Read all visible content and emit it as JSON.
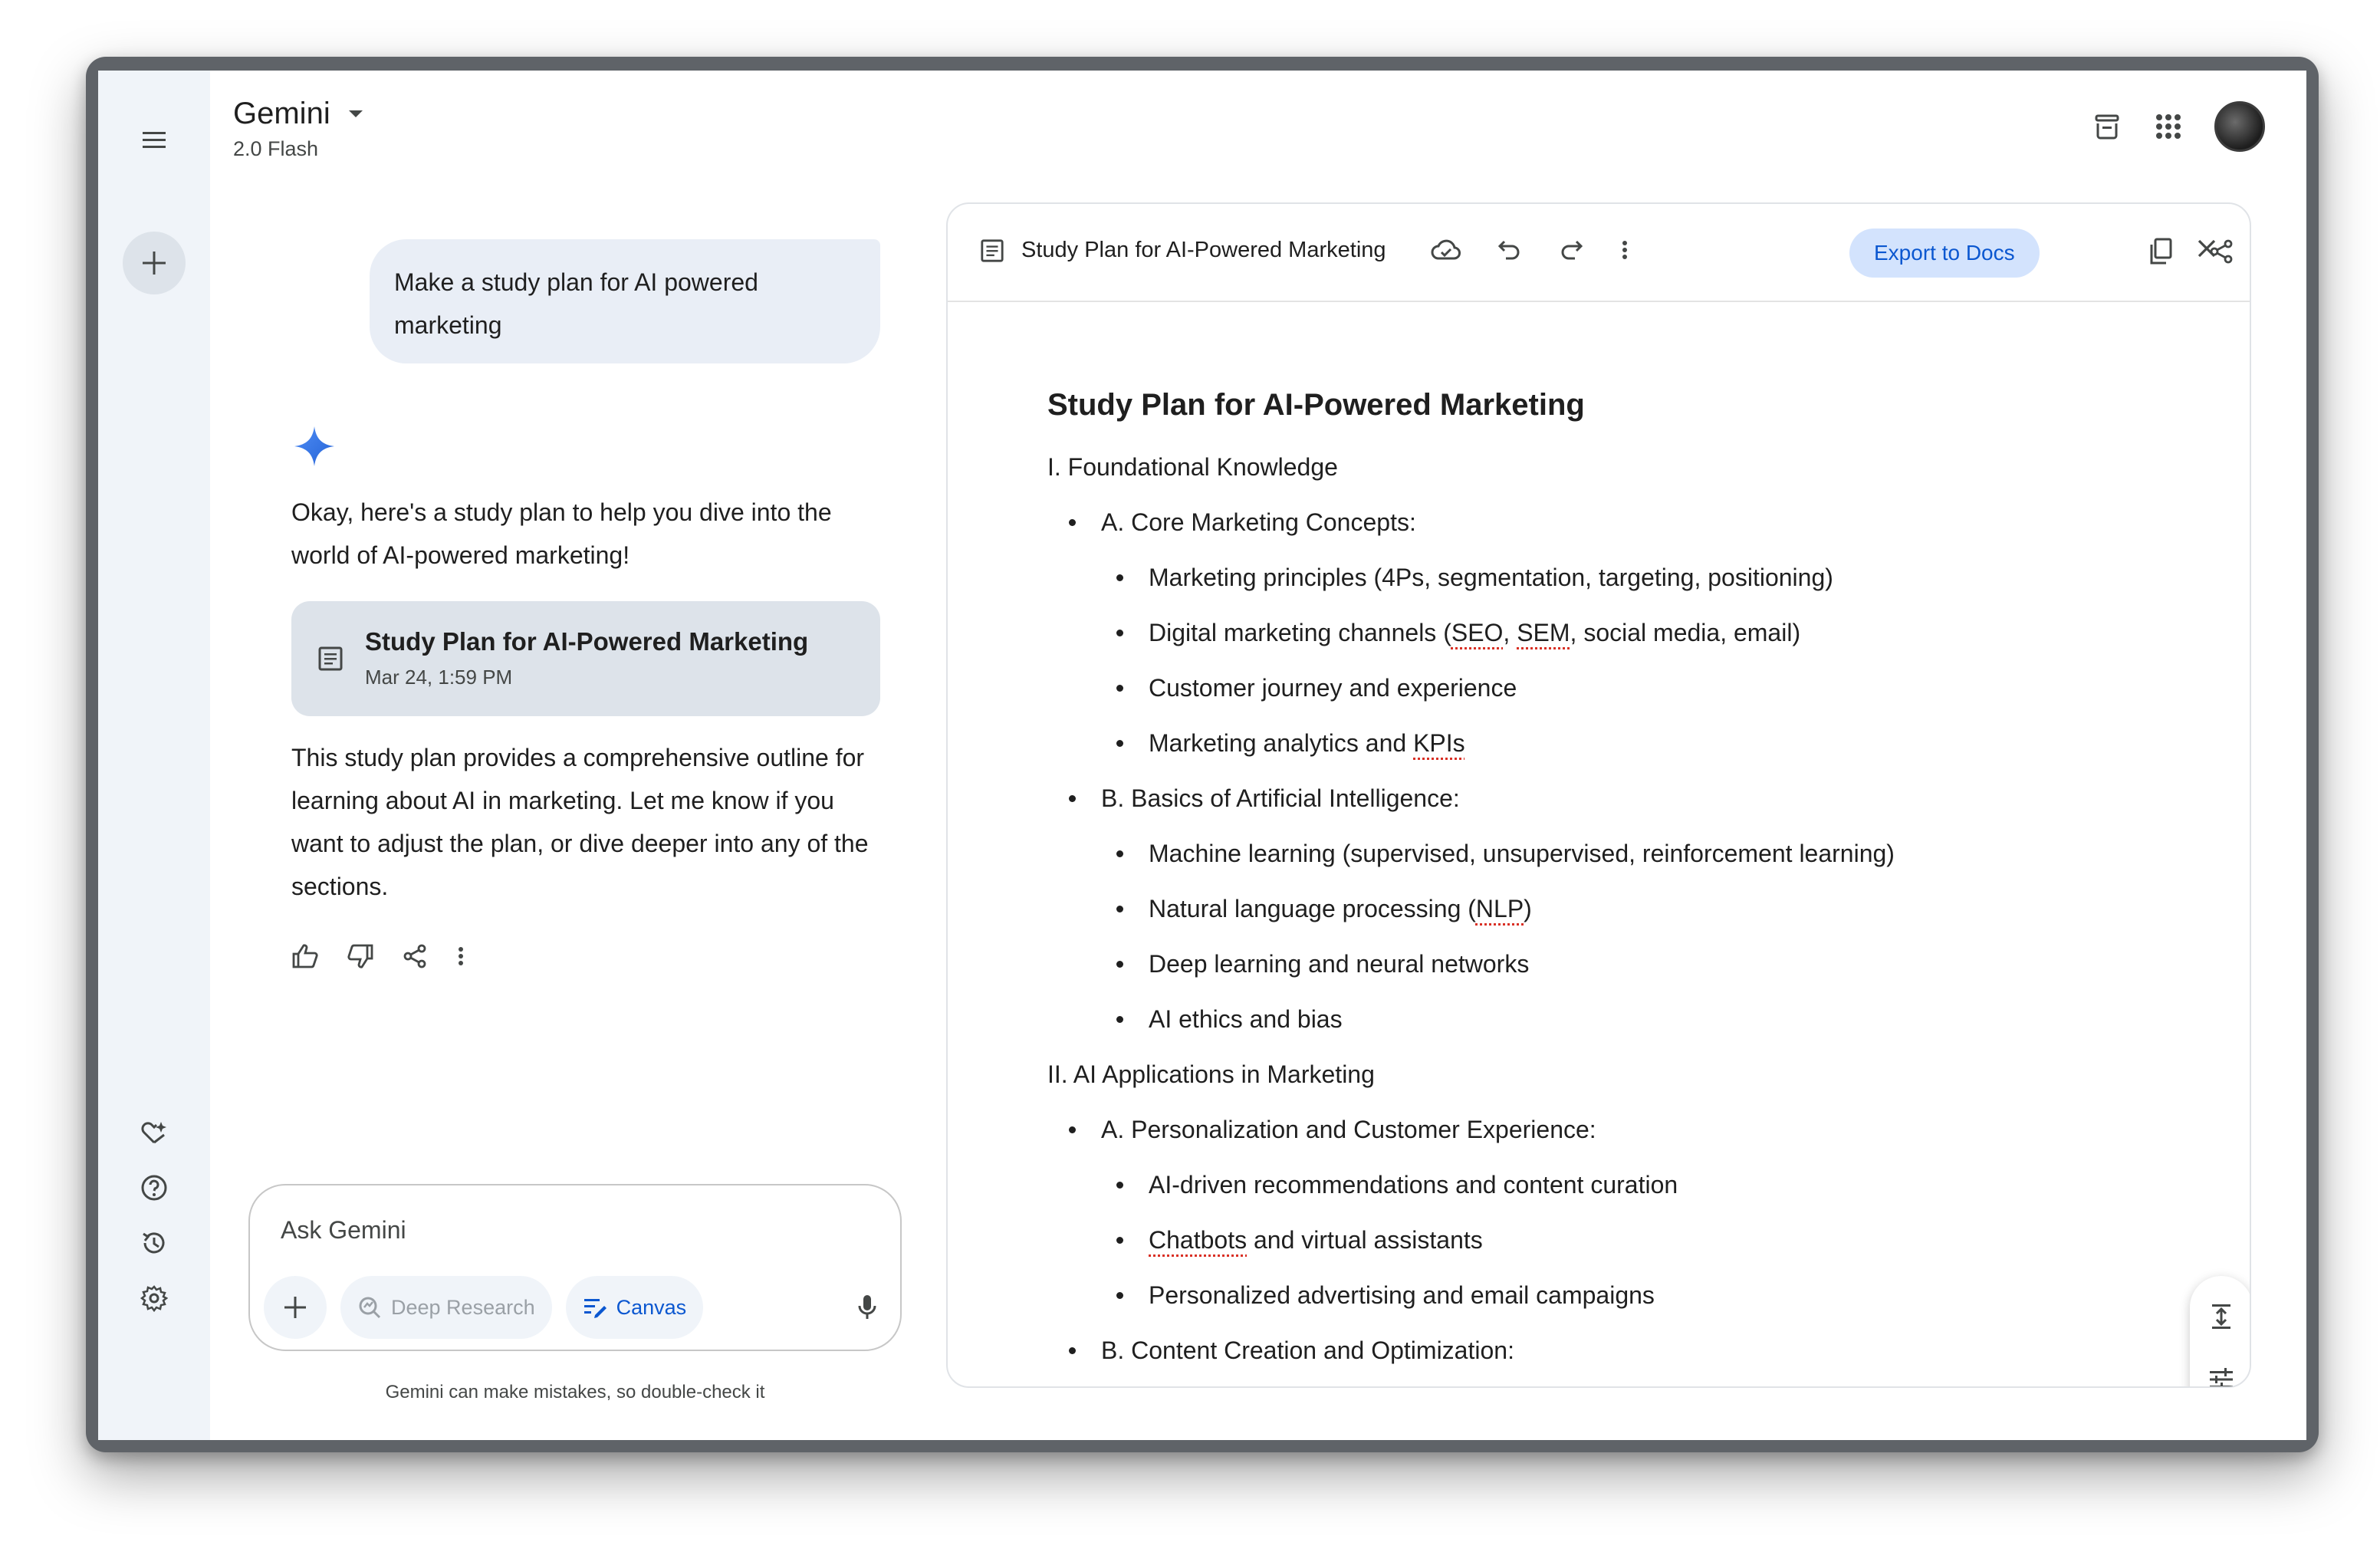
{
  "header": {
    "app_title": "Gemini",
    "model_label": "2.0 Flash"
  },
  "chat": {
    "user_message": "Make a study plan for AI powered marketing",
    "response_intro": "Okay, here's a study plan to help you dive into the world of AI-powered marketing!",
    "card": {
      "title": "Study Plan for AI-Powered Marketing",
      "date": "Mar 24, 1:59 PM"
    },
    "response_outro": "This study plan provides a comprehensive outline for learning about AI in marketing. Let me know if you want to adjust the plan, or dive deeper into any of the sections."
  },
  "input": {
    "placeholder": "Ask Gemini",
    "deep_research_label": "Deep Research",
    "canvas_label": "Canvas",
    "disclaimer": "Gemini can make mistakes, so double-check it"
  },
  "canvas": {
    "title": "Study Plan for AI-Powered Marketing",
    "export_label": "Export to Docs",
    "doc": {
      "heading": "Study Plan for AI-Powered Marketing",
      "section1": "I. Foundational Knowledge",
      "s1a": "A. Core Marketing Concepts:",
      "s1a_items": [
        "Marketing principles (4Ps, segmentation, targeting, positioning)",
        "Digital marketing channels (",
        "SEO",
        ", ",
        "SEM",
        ", social media, email)",
        "Customer journey and experience",
        "Marketing analytics and ",
        "KPIs"
      ],
      "s1b": "B. Basics of Artificial Intelligence:",
      "s1b_items": [
        "Machine learning (supervised, unsupervised, reinforcement learning)",
        "Natural language processing (",
        "NLP",
        ")",
        "Deep learning and neural networks",
        "AI ethics and bias"
      ],
      "section2": "II. AI Applications in Marketing",
      "s2a": "A. Personalization and Customer Experience:",
      "s2a_items": [
        "AI-driven recommendations and content curation",
        "Chatbots",
        " and virtual assistants",
        "Personalized advertising and email campaigns"
      ],
      "s2b": "B. Content Creation and Optimization:"
    }
  },
  "colors": {
    "accent": "#0b57d0",
    "rail_bg": "#f0f4f9",
    "chip_bg": "#d3e3fd",
    "user_bubble": "#e9eef6",
    "spellcheck": "#d93025"
  }
}
